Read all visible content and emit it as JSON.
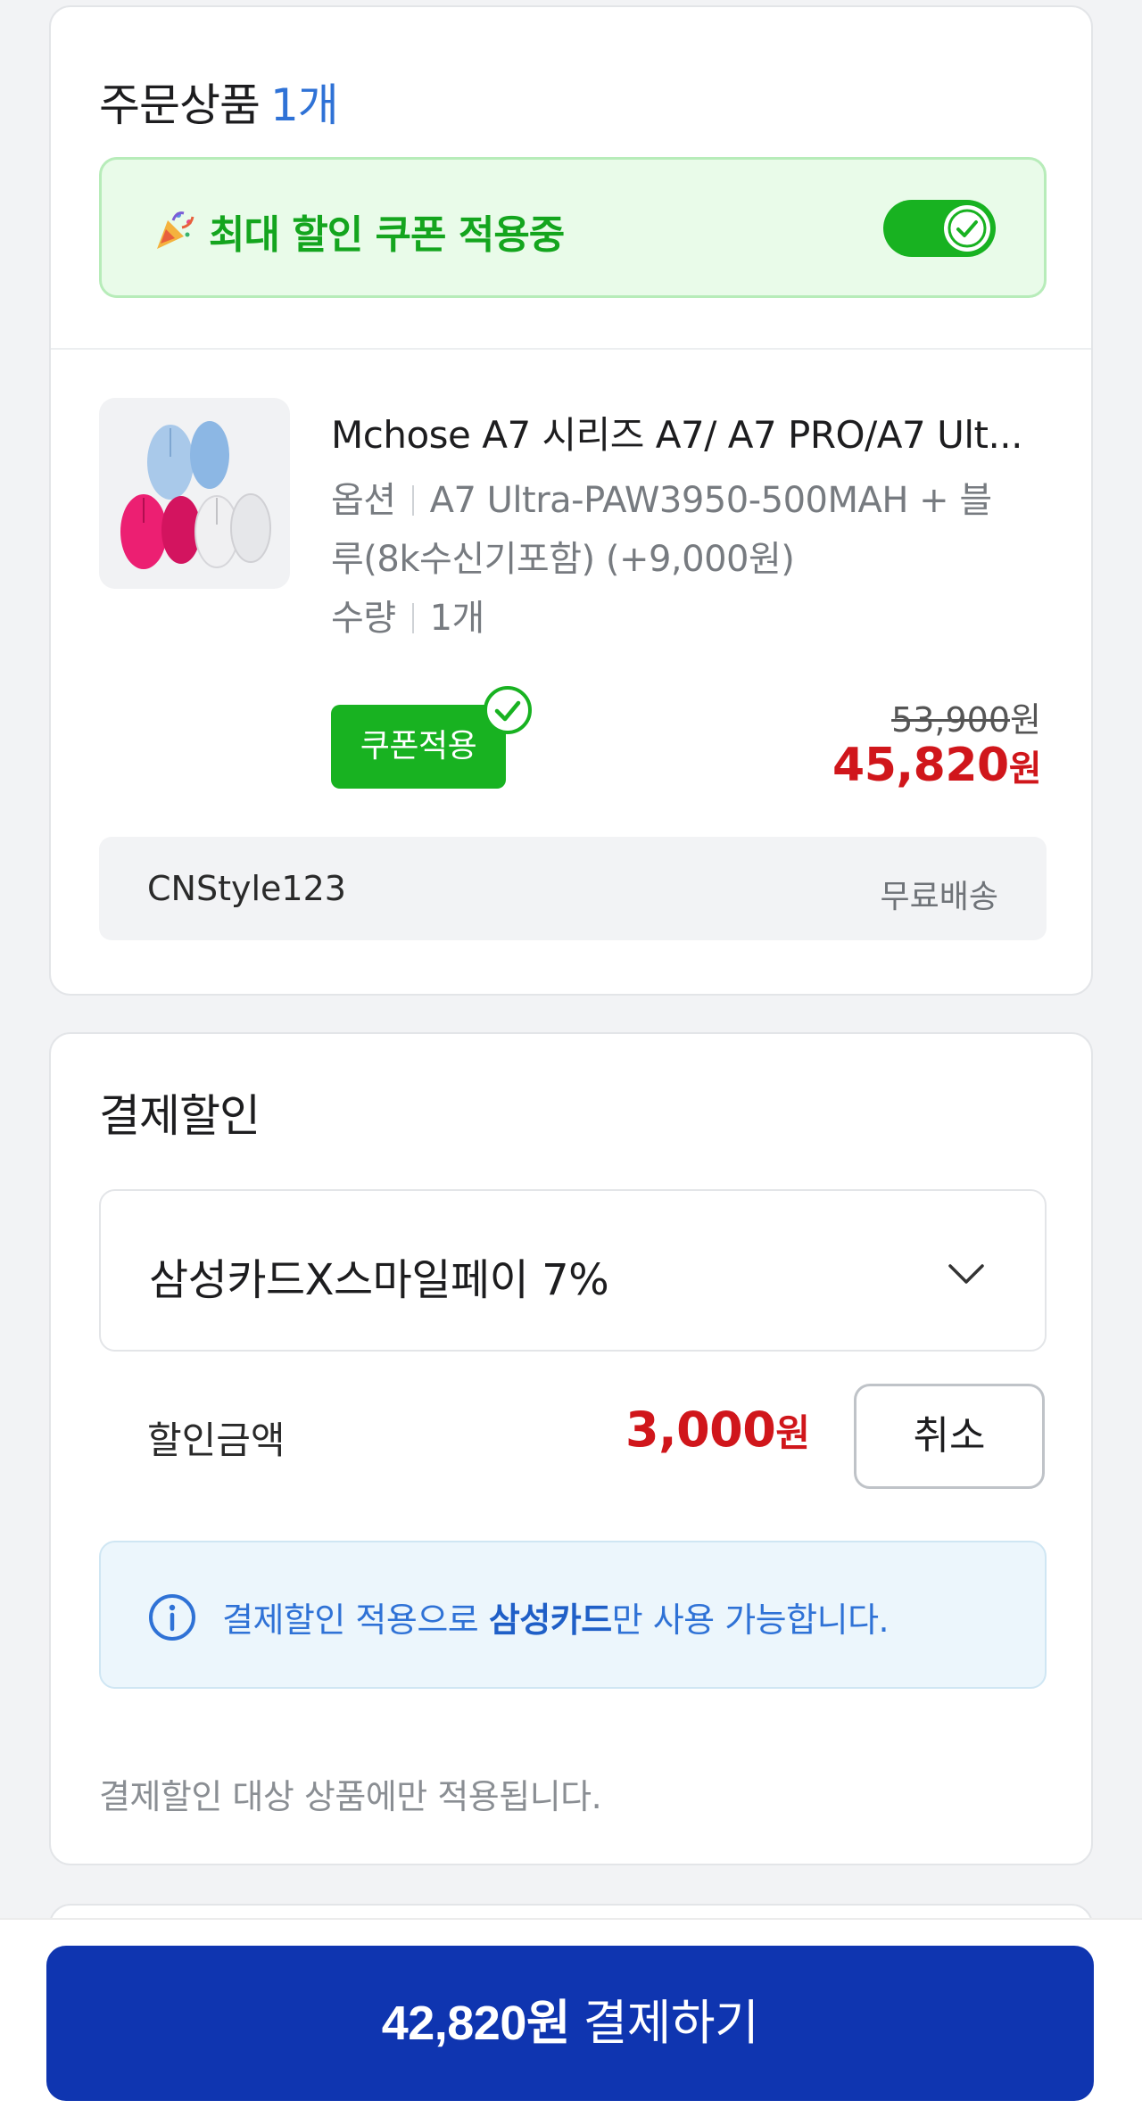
{
  "order": {
    "title": "주문상품",
    "count": "1개",
    "coupon_banner": "최대 할인 쿠폰 적용중",
    "coupon_toggle_on": true,
    "product": {
      "title": "Mchose A7 시리즈 A7/ A7 PRO/A7 Ult...",
      "option_label": "옵션",
      "option_value_line1": "A7 Ultra-PAW3950-500MAH + 블",
      "option_value_line2": "루(8k수신기포함) (+9,000원)",
      "qty_label": "수량",
      "qty_value": "1개",
      "coupon_badge": "쿠폰적용",
      "original_price": "53,900",
      "original_unit": "원",
      "sale_price": "45,820",
      "sale_unit": "원"
    },
    "seller": "CNStyle123",
    "shipping": "무료배송"
  },
  "payment_discount": {
    "title": "결제할인",
    "selected_card": "삼성카드X스마일페이 7%",
    "discount_label": "할인금액",
    "discount_amount": "3,000",
    "discount_unit": "원",
    "cancel_label": "취소",
    "info_prefix": "결제할인 적용으로 ",
    "info_bold": "삼성카드",
    "info_suffix": "만 사용 가능합니다.",
    "footnote": "결제할인 대상 상품에만 적용됩니다."
  },
  "checkout": {
    "amount": "42,820원",
    "label": "결제하기"
  },
  "colors": {
    "accent_blue": "#2f72d6",
    "coupon_green": "#18b221",
    "price_red": "#d0161b",
    "pay_button": "#0f35b0"
  }
}
